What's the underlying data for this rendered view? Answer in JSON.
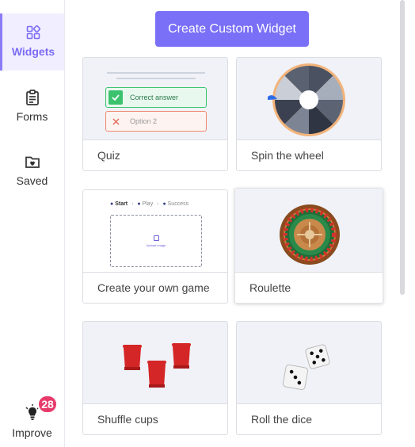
{
  "sidebar": {
    "items": [
      {
        "label": "Widgets",
        "icon": "widgets-grid-icon",
        "active": true
      },
      {
        "label": "Forms",
        "icon": "clipboard-icon",
        "active": false
      },
      {
        "label": "Saved",
        "icon": "folder-heart-icon",
        "active": false
      }
    ],
    "improve": {
      "label": "Improve",
      "icon": "lightbulb-icon",
      "badge": "28"
    }
  },
  "main": {
    "create_button": "Create Custom Widget",
    "cards": [
      {
        "title": "Quiz",
        "preview": {
          "correct": "Correct answer",
          "option": "Option 2"
        }
      },
      {
        "title": "Spin the wheel"
      },
      {
        "title": "Create your own game",
        "preview": {
          "steps": [
            "Start",
            "Play",
            "Success"
          ],
          "upload": "Upload image"
        }
      },
      {
        "title": "Roulette"
      },
      {
        "title": "Shuffle cups"
      },
      {
        "title": "Roll the dice"
      }
    ]
  },
  "colors": {
    "accent": "#7a6ff7",
    "badge": "#e73a6a",
    "correct": "#3cc26e",
    "wrong": "#f08a72"
  }
}
